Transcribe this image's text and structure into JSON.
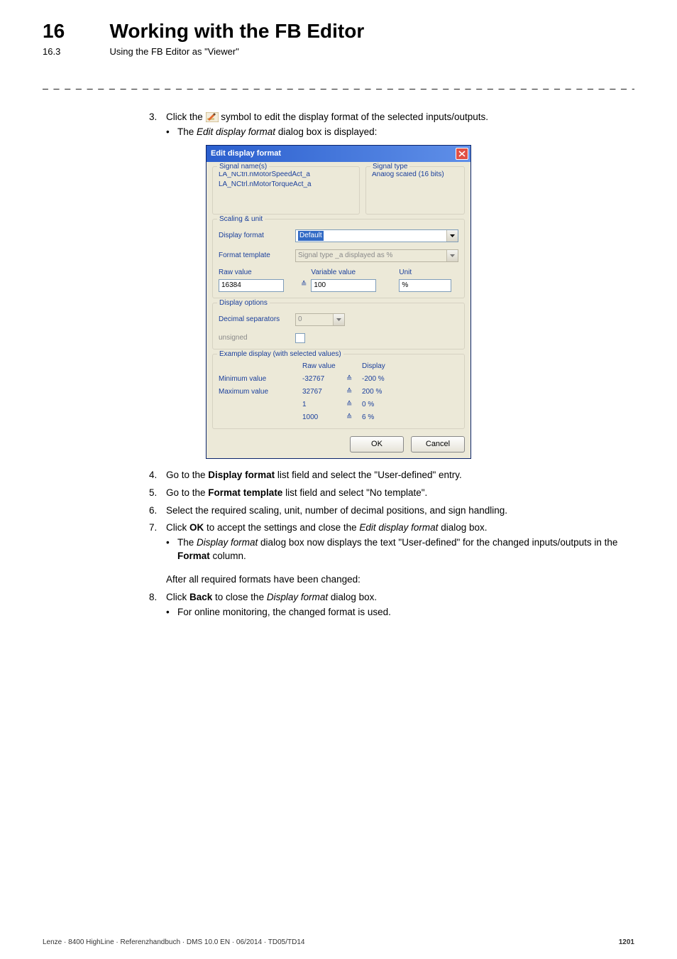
{
  "chapter": {
    "num": "16",
    "title": "Working with the FB Editor"
  },
  "section": {
    "num": "16.3",
    "title": "Using the FB Editor as \"Viewer\""
  },
  "dashline": "_ _ _ _ _ _ _ _ _ _ _ _ _ _ _ _ _ _ _ _ _ _ _ _ _ _ _ _ _ _ _ _ _ _ _ _ _ _ _ _ _ _ _ _ _ _ _ _ _ _ _ _ _ _ _ _ _ _ _ _ _ _ _ _",
  "steps": {
    "s3": {
      "num": "3.",
      "pre": "Click the ",
      "post": " symbol to edit the display format of the selected inputs/outputs.",
      "bullet_pre": "The ",
      "bullet_em": "Edit display format",
      "bullet_post": " dialog box is displayed:"
    },
    "s4": {
      "num": "4.",
      "pre": "Go to the ",
      "b": "Display format",
      "post": " list field and select the \"User-defined\" entry."
    },
    "s5": {
      "num": "5.",
      "pre": "Go to the ",
      "b": "Format template",
      "post": " list field and select \"No template\"."
    },
    "s6": {
      "num": "6.",
      "text": "Select the required scaling, unit, number of decimal positions, and sign handling."
    },
    "s7": {
      "num": "7.",
      "pre": "Click ",
      "b": "OK",
      "mid": " to accept the settings and close the ",
      "em": "Edit display format",
      "post": " dialog box.",
      "bullet_pre": "The ",
      "bullet_em": "Display format",
      "bullet_mid": " dialog box now displays the text \"User-defined\" for the changed inputs/outputs in the ",
      "bullet_b": "Format",
      "bullet_post": " column."
    },
    "after": "After all required formats have been changed:",
    "s8": {
      "num": "8.",
      "pre": "Click ",
      "b": "Back",
      "mid": " to close the ",
      "em": "Display format",
      "post": " dialog box.",
      "bullet": "For online monitoring, the changed format is used."
    }
  },
  "dialog": {
    "title": "Edit display format",
    "signal_names_legend": "Signal name(s)",
    "signal_names": [
      "LA_NCtrl.nMotorSpeedAct_a",
      "LA_NCtrl.nMotorTorqueAct_a"
    ],
    "signal_type_legend": "Signal type",
    "signal_type_value": "Analog scaled (16 bits)",
    "scaling_legend": "Scaling & unit",
    "display_format_label": "Display format",
    "display_format_value": "Default",
    "format_template_label": "Format template",
    "format_template_value": "Signal type _a displayed as %",
    "raw_value_label": "Raw value",
    "raw_value": "16384",
    "variable_value_label": "Variable value",
    "variable_value": "100",
    "unit_label": "Unit",
    "unit_value": "%",
    "display_options_legend": "Display options",
    "decimal_sep_label": "Decimal separators",
    "decimal_sep_value": "0",
    "unsigned_label": "unsigned",
    "example_legend": "Example display (with selected values)",
    "example": {
      "col_raw": "Raw value",
      "col_display": "Display",
      "rows": [
        {
          "label": "Minimum value",
          "raw": "-32767",
          "disp": "-200 %"
        },
        {
          "label": "Maximum value",
          "raw": "32767",
          "disp": "200 %"
        },
        {
          "label": "",
          "raw": "1",
          "disp": "0 %"
        },
        {
          "label": "",
          "raw": "1000",
          "disp": "6 %"
        }
      ]
    },
    "eq": "≙",
    "ok": "OK",
    "cancel": "Cancel"
  },
  "footer": {
    "left": "Lenze · 8400 HighLine · Referenzhandbuch · DMS 10.0 EN · 06/2014 · TD05/TD14",
    "right": "1201"
  }
}
